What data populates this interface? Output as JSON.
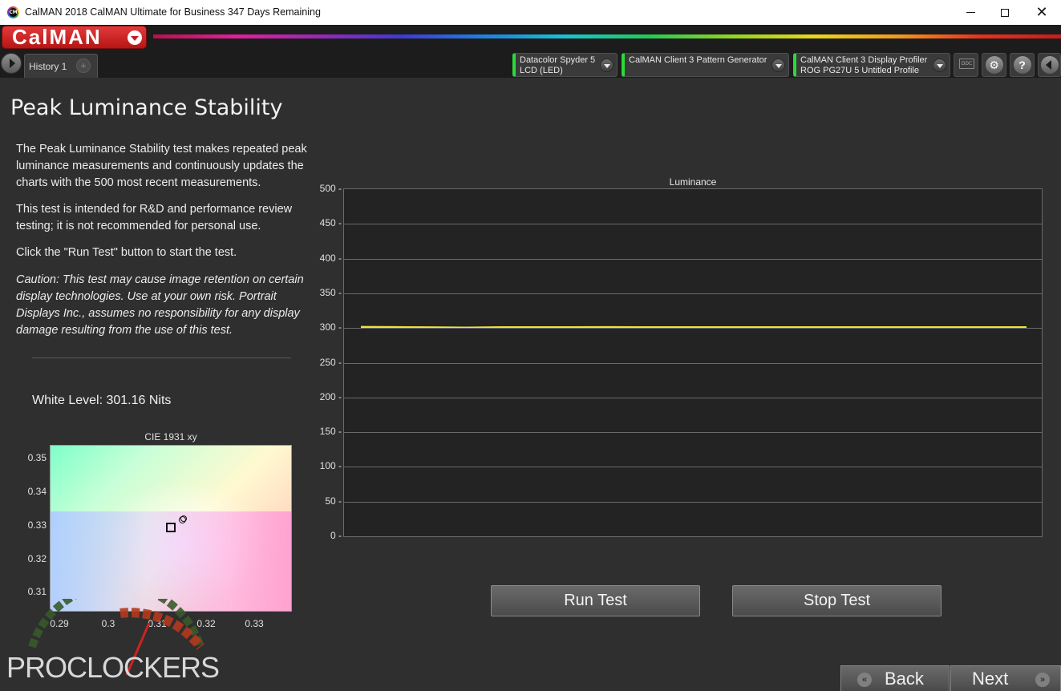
{
  "window": {
    "icon_text": "CM",
    "title": "CalMAN 2018 CalMAN Ultimate for Business 347 Days Remaining",
    "close_glyph": "✕"
  },
  "app": {
    "logo": "CalMAN"
  },
  "tabs": [
    {
      "label": "History 1"
    }
  ],
  "tab_add_glyph": "+",
  "devices": [
    {
      "line1": "Datacolor Spyder 5",
      "line2": "LCD (LED)",
      "status_color": "#2bd93a"
    },
    {
      "line1": "CalMAN Client 3 Pattern Generator",
      "line2": "",
      "status_color": "#2bd93a"
    },
    {
      "line1": "CalMAN Client 3 Display Profiler",
      "line2": "ROG PG27U 5 Untitled Profile",
      "status_color": "#2bd93a"
    }
  ],
  "toolbar": {
    "ddc_label": "DDC",
    "help_glyph": "?",
    "settings_glyph": "⚙"
  },
  "page": {
    "title": "Peak Luminance Stability",
    "paragraphs": [
      "The Peak Luminance Stability test makes repeated peak luminance measurements and continuously updates the charts with the 500 most recent measurements.",
      "This test is intended for R&D and performance review testing; it is not recommended for personal use.",
      "Click the \"Run Test\" button to start the test.",
      "Caution: This test may cause image retention on certain display technologies. Use at your own risk. Portrait Displays Inc., assumes no responsibility for any display damage resulting from the use of this test."
    ],
    "white_level": "White Level: 301.16 Nits"
  },
  "cie_chart": {
    "title": "CIE 1931 xy",
    "x_ticks": [
      "0.29",
      "0.3",
      "0.31",
      "0.32",
      "0.33"
    ],
    "y_ticks": [
      "0.35",
      "0.34",
      "0.33",
      "0.32",
      "0.31"
    ]
  },
  "buttons": {
    "run": "Run Test",
    "stop": "Stop Test",
    "back": "Back",
    "next": "Next",
    "back_glyph": "«",
    "next_glyph": "»"
  },
  "watermark": "PROCLOCKERS",
  "chart_data": {
    "type": "line",
    "title": "Luminance",
    "xlabel": "",
    "ylabel": "",
    "ylim": [
      0,
      500
    ],
    "y_ticks": [
      500,
      450,
      400,
      350,
      300,
      250,
      200,
      150,
      100,
      50,
      0
    ],
    "grid": true,
    "series": [
      {
        "color": "#f0e53a",
        "values": [
          301.5,
          301.3,
          300.9,
          300.6,
          301.0,
          301.2,
          301.1,
          301.3,
          301.1,
          301.0,
          301.2,
          301.1,
          301.0,
          301.1,
          301.2,
          301.1,
          301.1,
          301.2,
          301.1,
          301.2
        ]
      }
    ]
  }
}
